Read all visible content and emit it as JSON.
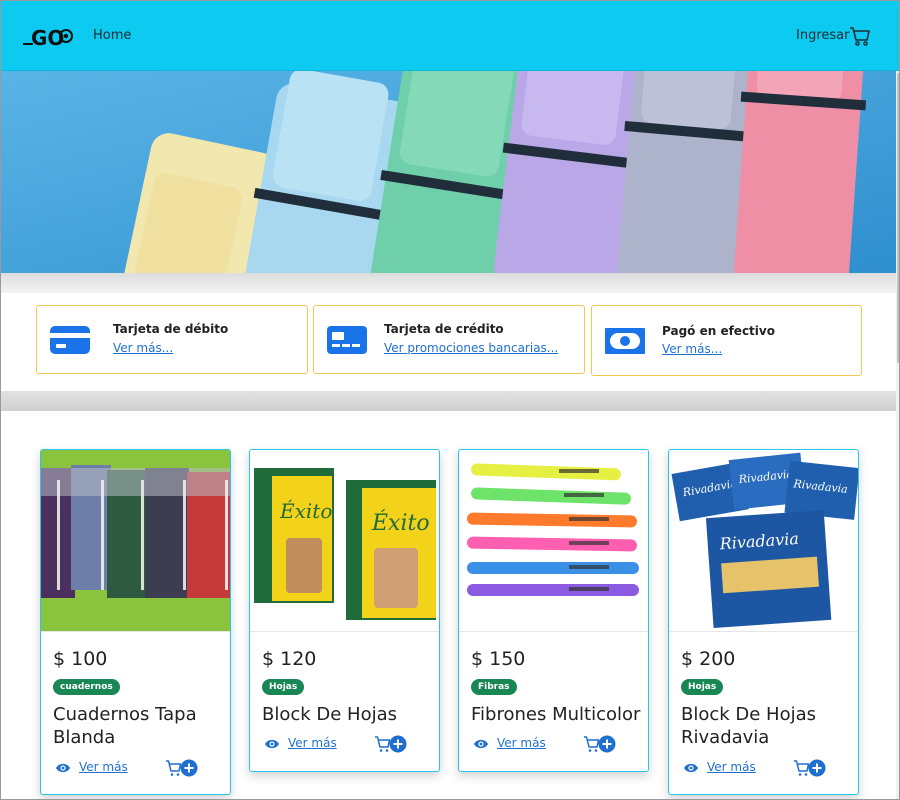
{
  "header": {
    "logo_text": "GO",
    "home_label": "Home",
    "login_label": "Ingresar",
    "cart_icon": "cart-icon"
  },
  "hero": {
    "description_icon": "highlighter-markers-banner"
  },
  "payments": [
    {
      "title": "Tarjeta de débito",
      "link": "Ver más...",
      "icon": "debit-card-icon"
    },
    {
      "title": "Tarjeta de crédito",
      "link": "Ver promociones bancarias...",
      "icon": "credit-card-icon"
    },
    {
      "title": "Pagó en efectivo",
      "link": "Ver más...",
      "icon": "cash-icon"
    }
  ],
  "products": [
    {
      "price": "$ 100",
      "category": "cuadernos",
      "name": "Cuadernos Tapa Blanda",
      "see_more": "Ver más"
    },
    {
      "price": "$ 120",
      "category": "Hojas",
      "name": "Block De Hojas",
      "see_more": "Ver más"
    },
    {
      "price": "$ 150",
      "category": "Fibras",
      "name": "Fibrones Multicolor",
      "see_more": "Ver más"
    },
    {
      "price": "$ 200",
      "category": "Hojas",
      "name": "Block De Hojas Rivadavia",
      "see_more": "Ver más"
    }
  ],
  "colors": {
    "navbar": "#0dcaf0",
    "accent_blue": "#1f6fd1",
    "badge_green": "#198754",
    "card_border": "#25c7ea",
    "payment_border": "#f2c94c"
  }
}
